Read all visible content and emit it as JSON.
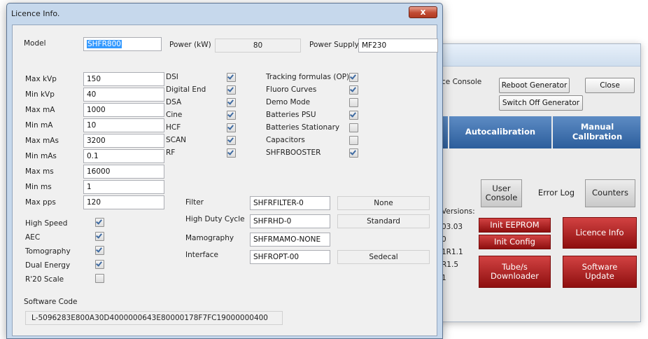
{
  "console": {
    "partial_title": "ce Console",
    "reboot_label": "Reboot Generator",
    "close_label": "Close",
    "switch_off_label": "Switch Off Generator",
    "autocalibration_label": "Autocalibration",
    "manual_calibration_label": "Manual Callbration",
    "user_console_label": "User Console",
    "error_log_label": "Error Log",
    "counters_label": "Counters",
    "versions_label": "Versions:",
    "version_values": [
      "03.03",
      "0",
      "1R1.1",
      "R1.5",
      "1"
    ],
    "init_eeprom_label": "Init EEPROM",
    "init_config_label": "Init Config",
    "licence_info_label": "Licence Info",
    "tube_downloader_label": "Tube/s Downloader",
    "software_update_label": "Software Update"
  },
  "dialog": {
    "title": "Licence Info.",
    "close_glyph": "x",
    "model_label": "Model",
    "model_value": "SHFR800",
    "power_label": "Power (kW)",
    "power_value": "80",
    "power_supply_label": "Power Supply",
    "power_supply_value": "MF230",
    "limits": [
      {
        "label": "Max kVp",
        "value": "150"
      },
      {
        "label": "Min kVp",
        "value": "40"
      },
      {
        "label": "Max mA",
        "value": "1000"
      },
      {
        "label": "Min mA",
        "value": "10"
      },
      {
        "label": "Max mAs",
        "value": "3200"
      },
      {
        "label": "Min mAs",
        "value": "0.1"
      },
      {
        "label": "Max ms",
        "value": "16000"
      },
      {
        "label": "Min ms",
        "value": "1"
      },
      {
        "label": "Max pps",
        "value": "120"
      }
    ],
    "features_mid": [
      {
        "label": "DSI",
        "checked": true
      },
      {
        "label": "Digital End",
        "checked": true
      },
      {
        "label": "DSA",
        "checked": true
      },
      {
        "label": "Cine",
        "checked": true
      },
      {
        "label": "HCF",
        "checked": true
      },
      {
        "label": "SCAN",
        "checked": true
      },
      {
        "label": "RF",
        "checked": true
      }
    ],
    "features_right": [
      {
        "label": "Tracking formulas (OP)",
        "checked": true
      },
      {
        "label": "Fluoro Curves",
        "checked": true
      },
      {
        "label": "Demo Mode",
        "checked": false
      },
      {
        "label": "Batteries PSU",
        "checked": true
      },
      {
        "label": "Batteries Stationary",
        "checked": false
      },
      {
        "label": "Capacitors",
        "checked": false
      },
      {
        "label": "SHFRBOOSTER",
        "checked": true
      }
    ],
    "features_left": [
      {
        "label": "High Speed",
        "checked": true
      },
      {
        "label": "AEC",
        "checked": true
      },
      {
        "label": "Tomography",
        "checked": true
      },
      {
        "label": "Dual Energy",
        "checked": true
      },
      {
        "label": "R'20 Scale",
        "checked": false
      }
    ],
    "options": [
      {
        "label": "Filter",
        "value": "SHFRFILTER-0",
        "desc": "None"
      },
      {
        "label": "High Duty Cycle",
        "value": "SHFRHD-0",
        "desc": "Standard"
      },
      {
        "label": "Mamography",
        "value": "SHFRMAMO-NONE",
        "desc": ""
      },
      {
        "label": "Interface",
        "value": "SHFROPT-00",
        "desc": "Sedecal"
      }
    ],
    "software_code_label": "Software Code",
    "software_code_value": "L-5096283E800A30D4000000643E80000178F7FC19000000400"
  },
  "colors": {
    "accent_blue": "#2c5e9c",
    "accent_red": "#b31d1d",
    "selection": "#3399ff"
  }
}
